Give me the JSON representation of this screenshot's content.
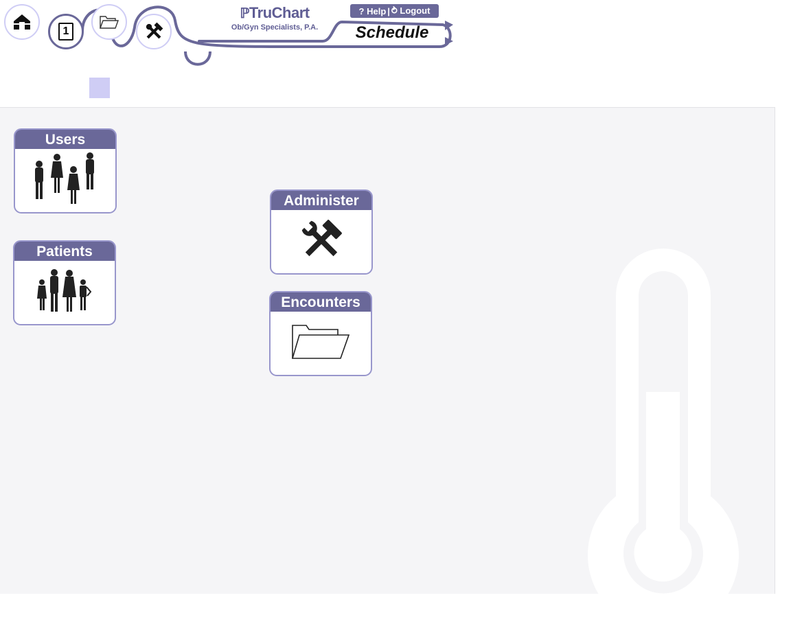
{
  "header": {
    "brand_name": "TruChart",
    "brand_mark": "ℙ",
    "practice_name": "Ob/Gyn Specialists, P.A.",
    "help_label": "? Help",
    "separator": "|",
    "logout_label": "⥁ Logout",
    "active_tab_label": "Schedule",
    "nav_icons": [
      "home-icon",
      "calendar-icon",
      "folder-icon",
      "tools-icon"
    ],
    "calendar_day": "1"
  },
  "tiles": {
    "users": {
      "label": "Users",
      "icon": "users-icon"
    },
    "patients": {
      "label": "Patients",
      "icon": "family-icon"
    },
    "administer": {
      "label": "Administer",
      "icon": "tools-icon"
    },
    "encounters": {
      "label": "Encounters",
      "icon": "folder-icon"
    }
  },
  "watermark": {
    "icon": "thermometer-icon"
  },
  "colors": {
    "accent": "#6a6899",
    "tile_border": "#9896cc",
    "workspace_bg": "#f5f5f7",
    "watermark": "#ffffff",
    "highlight_square": "#cfcdf5"
  }
}
